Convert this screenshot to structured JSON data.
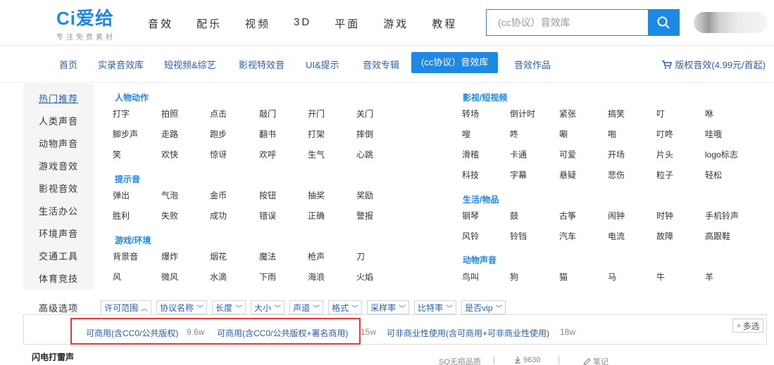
{
  "logo": {
    "text": "Ci爱给",
    "slogan": "专注免费素材"
  },
  "topnav": [
    "音效",
    "配乐",
    "视频",
    "3D",
    "平面",
    "游戏",
    "教程"
  ],
  "search": {
    "placeholder": "(cc协议）音效库"
  },
  "subnav": {
    "items": [
      "首页",
      "实录音效库",
      "短视频&综艺",
      "影视特效音",
      "UI&提示",
      "音效专辑",
      "(cc协议）音效库",
      "音效作品"
    ],
    "active_index": 6,
    "cart": "版权音效(4.99元/首起)"
  },
  "sidebar": [
    "热门推荐",
    "人类声音",
    "动物声音",
    "游戏音效",
    "影视音效",
    "生活办公",
    "环境声音",
    "交通工具",
    "体育竞技"
  ],
  "groups": {
    "people": {
      "title": "人物动作",
      "rows": [
        [
          "打字",
          "拍照",
          "点击",
          "敲门",
          "开门",
          "关门"
        ],
        [
          "脚步声",
          "走路",
          "跑步",
          "翻书",
          "打架",
          "摔倒"
        ],
        [
          "笑",
          "欢快",
          "惊讶",
          "欢呼",
          "生气",
          "心跳"
        ]
      ]
    },
    "prompt": {
      "title": "提示音",
      "rows": [
        [
          "弹出",
          "气泡",
          "金币",
          "按钮",
          "抽奖",
          "奖励"
        ],
        [
          "胜利",
          "失败",
          "成功",
          "错误",
          "正确",
          "警报"
        ]
      ]
    },
    "game": {
      "title": "游戏/环境",
      "rows": [
        [
          "背景音",
          "爆炸",
          "烟花",
          "魔法",
          "枪声",
          "刀"
        ],
        [
          "风",
          "微风",
          "水滴",
          "下雨",
          "海浪",
          "火焰"
        ]
      ]
    },
    "film": {
      "title": "影视/短视频",
      "rows": [
        [
          "转场",
          "倒计时",
          "紧张",
          "搞笑",
          "叮",
          "咻"
        ],
        [
          "嗖",
          "咚",
          "唰",
          "啪",
          "叮咚",
          "哇哦"
        ],
        [
          "滑稽",
          "卡通",
          "可爱",
          "开场",
          "片头",
          "logo标志"
        ],
        [
          "科技",
          "字幕",
          "悬疑",
          "悲伤",
          "粒子",
          "轻松"
        ]
      ]
    },
    "life": {
      "title": "生活/物品",
      "rows": [
        [
          "钢琴",
          "鼓",
          "古筝",
          "闹钟",
          "时钟",
          "手机铃声"
        ],
        [
          "风铃",
          "铃铛",
          "汽车",
          "电流",
          "故障",
          "高跟鞋"
        ]
      ]
    },
    "animal": {
      "title": "动物声音",
      "rows": [
        [
          "鸟叫",
          "狗",
          "猫",
          "马",
          "牛",
          "羊"
        ]
      ]
    }
  },
  "advanced": {
    "label": "高级选项",
    "filters": [
      "许可范围",
      "协议名称",
      "长度",
      "大小",
      "声道",
      "格式",
      "采样率",
      "比特率",
      "是否vip"
    ],
    "active_filter": 0,
    "options": [
      {
        "label": "可商用(含CC0/公共版权)",
        "count": "9.6w"
      },
      {
        "label": "可商用(含CC0/公共版权+署名商用)",
        "count": "15w"
      },
      {
        "label": "可非商业性使用(含可商用+可非商业性使用)",
        "count": "18w"
      }
    ],
    "multi_label": "多选"
  },
  "result": {
    "title": "闪电打雷声",
    "quality": "SQ无损品质",
    "downloads": "9630",
    "note": "笔记"
  },
  "colors": {
    "brand": "#1e88e5",
    "link": "#2a5ea8",
    "highlight": "#e53935"
  }
}
